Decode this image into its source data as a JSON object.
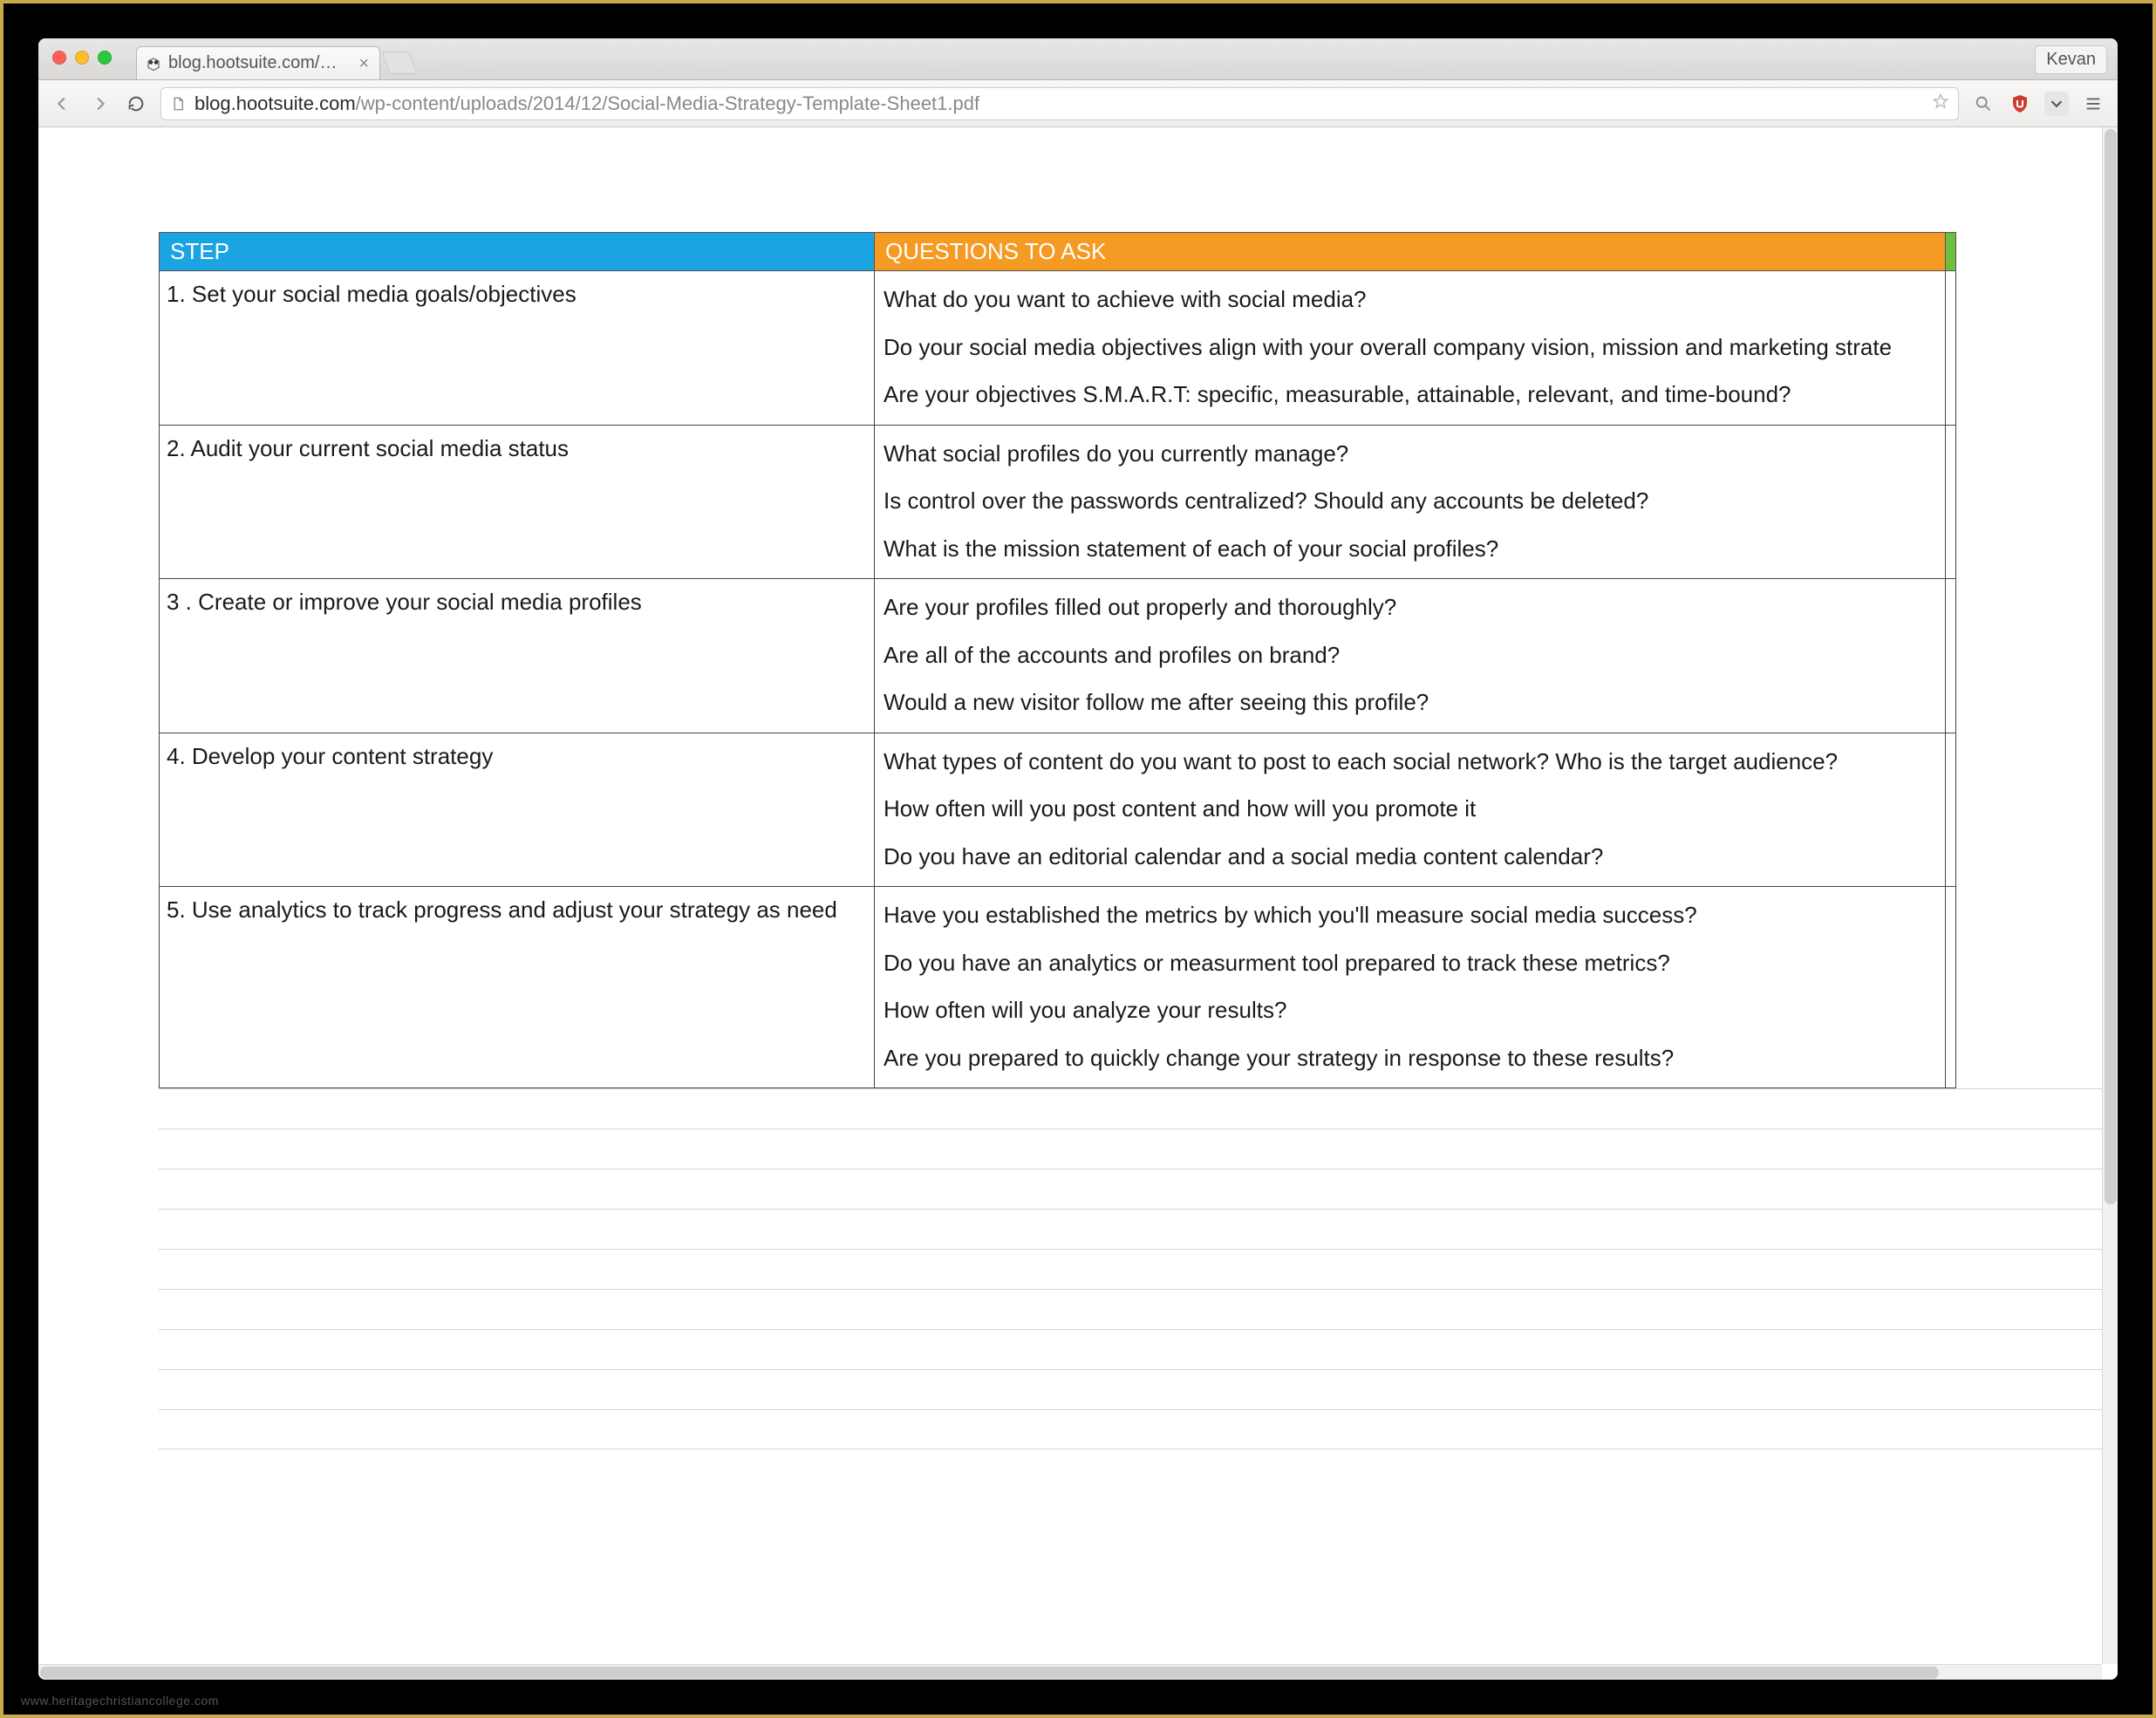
{
  "watermark": "www.heritagechristiancollege.com",
  "browser": {
    "user": "Kevan",
    "tab_title": "blog.hootsuite.com/wp-co",
    "url_domain": "blog.hootsuite.com",
    "url_path": "/wp-content/uploads/2014/12/Social-Media-Strategy-Template-Sheet1.pdf"
  },
  "table": {
    "headers": {
      "step": "STEP",
      "questions": "QUESTIONS TO ASK"
    },
    "rows": [
      {
        "step": "1. Set your social media goals/objectives",
        "questions": [
          "What do you want to achieve with social media?",
          "Do your social media objectives align with your overall company vision, mission and marketing strate",
          "Are your objectives S.M.A.R.T: specific, measurable, attainable, relevant, and time-bound?"
        ]
      },
      {
        "step": "2. Audit your current social media status",
        "questions": [
          "What social profiles do you currently manage?",
          "Is control over the passwords centralized? Should any accounts be deleted?",
          "What is the mission statement of each of your social profiles?"
        ]
      },
      {
        "step": "3 . Create or improve your social media profiles",
        "questions": [
          "Are your profiles filled out properly and thoroughly?",
          "Are all of the accounts and profiles on brand?",
          "Would a new visitor follow me after seeing this profile?"
        ]
      },
      {
        "step": "4. Develop your content strategy",
        "questions": [
          "What types of content do you want to post to each social network? Who is the target audience?",
          "How often will you post content and how will you promote it",
          "Do you have an editorial calendar and a social media content calendar?"
        ]
      },
      {
        "step": "5. Use analytics to track progress and adjust your strategy as need",
        "questions": [
          "Have you established the metrics by which you'll measure social media success?",
          "Do you have an analytics or measurment tool prepared to track these metrics?",
          "How often will you analyze your results?",
          "Are you prepared to quickly change your strategy in response to these results?"
        ]
      }
    ],
    "ghost_row_count": 9
  }
}
